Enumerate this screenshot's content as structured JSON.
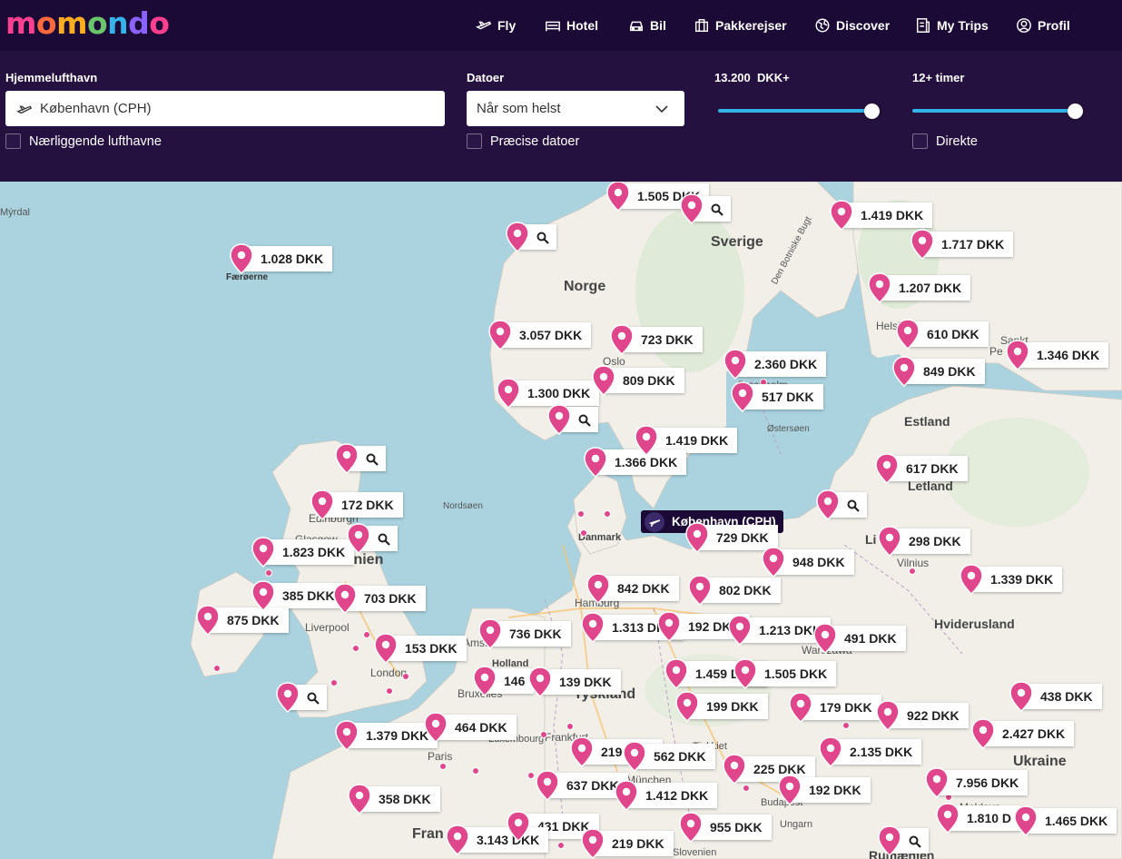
{
  "brand": {
    "logo_parts": [
      "m",
      "o",
      "m",
      "o",
      "n",
      "d",
      "o"
    ]
  },
  "nav": {
    "fly": "Fly",
    "hotel": "Hotel",
    "bil": "Bil",
    "pakkerejser": "Pakkerejser",
    "discover": "Discover",
    "my_trips": "My Trips",
    "profil": "Profil"
  },
  "filters": {
    "origin_label": "Hjemmelufthavn",
    "origin_value": "København (CPH)",
    "nearby_label": "Nærliggende lufthavne",
    "dates_label": "Datoer",
    "dates_value": "Når som helst",
    "precise_label": "Præcise datoer",
    "price_label": "13.200  DKK+",
    "price_fraction": 1.0,
    "duration_label": "12+ timer",
    "duration_fraction": 1.0,
    "direct_label": "Direkte"
  },
  "map": {
    "home_label": "København (CPH)",
    "places": {
      "sverige": "Sverige",
      "norge": "Norge",
      "estland": "Estland",
      "letland": "Letland",
      "storbritannien": "Storbritannien",
      "tyskland": "Tyskland",
      "ukraine": "Ukraine",
      "hviderusland": "Hviderusland",
      "danmark": "Danmark",
      "holland": "Holland",
      "frankrig": "Fran",
      "helsingfors": "Helsingfors",
      "oslo": "Oslo",
      "stockholm": "Stockholm",
      "edinburgh": "Edinburgh",
      "glasgow": "Glasgow",
      "liverpool": "Liverpool",
      "london": "London",
      "paris": "Paris",
      "hamburg": "Hamburg",
      "bruxelles": "Bruxelles",
      "amsterdam": "Amsterdam",
      "frankfurt": "Frankfurt",
      "luxembourg": "Luxembourg",
      "tjekkiet": "Tjekkiet",
      "ungarn": "Ungarn",
      "budapest": "Budapest",
      "warszawa": "Warszawa",
      "vilnius": "Vilnius",
      "moldova": "Moldova",
      "slovenien": "Slovenien",
      "faeroerne": "Færøerne",
      "nordsoen": "Nordsøen",
      "ostersoen": "Østersøen",
      "botniske": "Den Botniske Bugt",
      "sankt": "Sankt",
      "pe": "Pe",
      "mjrdal": "Mýrdal",
      "li": "Li",
      "munchen": "München",
      "rumaenien": "Rumænien"
    },
    "prices": [
      {
        "id": "p01",
        "label": "1.505 DKK"
      },
      {
        "id": "p02",
        "label": "1.419 DKK"
      },
      {
        "id": "p03",
        "label": "1.717 DKK"
      },
      {
        "id": "p04",
        "label": "1.028 DKK"
      },
      {
        "id": "p05",
        "label": "1.207 DKK"
      },
      {
        "id": "p06",
        "label": "3.057 DKK"
      },
      {
        "id": "p07",
        "label": "723 DKK"
      },
      {
        "id": "p08",
        "label": "610 DKK"
      },
      {
        "id": "p09",
        "label": "1.346 DKK"
      },
      {
        "id": "p10",
        "label": "2.360 DKK"
      },
      {
        "id": "p11",
        "label": "849 DKK"
      },
      {
        "id": "p12",
        "label": "809 DKK"
      },
      {
        "id": "p13",
        "label": "1.300 DKK"
      },
      {
        "id": "p14",
        "label": "517 DKK"
      },
      {
        "id": "p15",
        "label": "1.419 DKK"
      },
      {
        "id": "p16",
        "label": "1.366 DKK"
      },
      {
        "id": "p17",
        "label": "617 DKK"
      },
      {
        "id": "p18",
        "label": "172 DKK"
      },
      {
        "id": "p19",
        "label": "729 DKK"
      },
      {
        "id": "p20",
        "label": "1.823 DKK"
      },
      {
        "id": "p21",
        "label": "298 DKK"
      },
      {
        "id": "p22",
        "label": "948 DKK"
      },
      {
        "id": "p23",
        "label": "1.339 DKK"
      },
      {
        "id": "p24",
        "label": "842 DKK"
      },
      {
        "id": "p25",
        "label": "802 DKK"
      },
      {
        "id": "p26",
        "label": "385 DKK"
      },
      {
        "id": "p27",
        "label": "703 DKK"
      },
      {
        "id": "p28",
        "label": "875 DKK"
      },
      {
        "id": "p29",
        "label": "736 DKK"
      },
      {
        "id": "p30",
        "label": "1.313 DKK"
      },
      {
        "id": "p31",
        "label": "192 DKK"
      },
      {
        "id": "p32",
        "label": "1.213 DKK"
      },
      {
        "id": "p33",
        "label": "491 DKK"
      },
      {
        "id": "p34",
        "label": "153 DKK"
      },
      {
        "id": "p35",
        "label": "146"
      },
      {
        "id": "p36",
        "label": "139 DKK"
      },
      {
        "id": "p37",
        "label": "1.459 DKK"
      },
      {
        "id": "p38",
        "label": "1.505 DKK"
      },
      {
        "id": "p39",
        "label": "199 DKK"
      },
      {
        "id": "p40",
        "label": "179 DKK"
      },
      {
        "id": "p41",
        "label": "922 DKK"
      },
      {
        "id": "p42",
        "label": "438 DKK"
      },
      {
        "id": "p43",
        "label": "1.379 DKK"
      },
      {
        "id": "p44",
        "label": "464 DKK"
      },
      {
        "id": "p45",
        "label": "2.427 DKK"
      },
      {
        "id": "p46",
        "label": "219 DKK"
      },
      {
        "id": "p47",
        "label": "562 DKK"
      },
      {
        "id": "p48",
        "label": "2.135 DKK"
      },
      {
        "id": "p49",
        "label": "225 DKK"
      },
      {
        "id": "p50",
        "label": "637 DKK"
      },
      {
        "id": "p51",
        "label": "1.412 DKK"
      },
      {
        "id": "p52",
        "label": "192 DKK"
      },
      {
        "id": "p53",
        "label": "7.956 DKK"
      },
      {
        "id": "p54",
        "label": "358 DKK"
      },
      {
        "id": "p55",
        "label": "1.810 D"
      },
      {
        "id": "p56",
        "label": "1.465 DKK"
      },
      {
        "id": "p57",
        "label": "431 DKK"
      },
      {
        "id": "p58",
        "label": "955 DKK"
      },
      {
        "id": "p59",
        "label": "3.143 DKK"
      },
      {
        "id": "p60",
        "label": "219 DKK"
      }
    ]
  },
  "colors": {
    "header": "#1b0a36",
    "filterbar": "#25113f",
    "accent": "#33b3e8",
    "pin": "#e0468c",
    "water": "#aad3df",
    "land": "#f1efe8"
  }
}
